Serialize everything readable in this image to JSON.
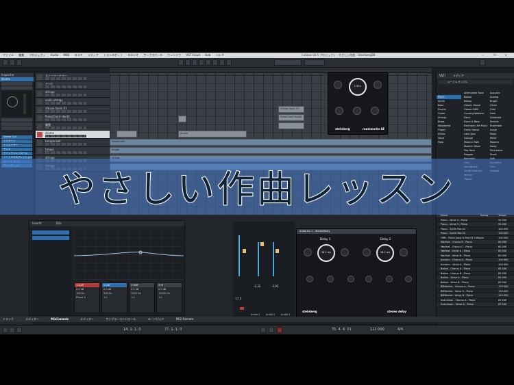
{
  "menubar": {
    "items": [
      "ファイル",
      "編集",
      "プロジェクト",
      "Audio",
      "MIDI",
      "スコア",
      "メディア",
      "トランスポート",
      "スタジオ",
      "ワークスペース",
      "ウィンドウ",
      "VST Cloud",
      "Hub",
      "ヘルプ"
    ],
    "title": "Cubase 10.5 プロジェクト - やさしい作曲 - SteinbergDB",
    "controls": "— ❐ ✕"
  },
  "project_label": "最終更新: 1/1 プロジェクト",
  "inspector": {
    "header_left": "Inspector",
    "header_right": "Visibility",
    "track_name": "drums",
    "blue_items": [
      "Stereo Out",
      "インサート",
      "イコライザー",
      "センド",
      "クイックコントロール",
      "ノートエクスプレッション",
      "コードトラック",
      "ディレクション"
    ]
  },
  "tracks": [
    {
      "name": "ストーリーテラー"
    },
    {
      "name": "アンビ"
    },
    {
      "name": "strings"
    },
    {
      "name": "violin strings"
    },
    {
      "name": "VSLow Sonic 01"
    },
    {
      "name": "PulseChord Hard4"
    },
    {
      "name": "鍵盤"
    },
    {
      "name": "drums"
    },
    {
      "name": "temple bell"
    },
    {
      "name": "tonpoi"
    },
    {
      "name": "strings"
    },
    {
      "name": "strings"
    }
  ],
  "clips": {
    "drums": "drums",
    "temple": "Inkake bell",
    "tonpoi": "tonpoi",
    "strings": "strings",
    "vs1": "VSLow Sonic 01",
    "pulse": "PulseChord Hard4"
  },
  "room_plugin": {
    "brand": "steinberg",
    "name": "roomworks SE",
    "center_value": "1.55 s",
    "values": [
      "Pre-Delay",
      "Reverb Time",
      "Diffusion",
      "Mix"
    ]
  },
  "delay_plugin": {
    "title": "Audio Ins 1 - StereoDelay",
    "brand": "steinberg",
    "name": "stereo delay",
    "delay1_label": "Delay 1",
    "delay2_label": "Delay 2",
    "delay1_value": "18.1 ms",
    "delay2_value": "18.1 ms",
    "row_labels": [
      "FEEDBACK",
      "FILTER",
      "LO",
      "HI",
      "PAN"
    ]
  },
  "media_bay": {
    "tabs": [
      "VSTi",
      "メディア"
    ],
    "search_label": "ループ & サンプル",
    "col_categories": [
      "Piano",
      "Synth",
      "Bass",
      "Drums",
      "Guitar",
      "Strings",
      "Brass",
      "Woodwind",
      "Organ",
      "Ethnic",
      "Vocal",
      "Pads"
    ],
    "col_styles": [
      "Alternative Rock",
      "Ballad",
      "Bebop",
      "Classic House",
      "Classic R&B",
      "Country/Western",
      "Disco",
      "Drum & Bass",
      "Electronic Art Music",
      "Funky House",
      "Latin Jazz",
      "Lounge",
      "Modern R&B",
      "Modern Wave",
      "Pop Rock",
      "Reggae",
      "Romantic",
      "Soul",
      "Soundtrack",
      "South America",
      "Techno",
      "Trance"
    ],
    "col_moods": [
      "Acoustic",
      "Analog",
      "Bright",
      "Clean",
      "Cold",
      "Dark",
      "Distorted",
      "Electric",
      "Ensemble",
      "Large",
      "Major",
      "Minor",
      "Modern",
      "Noisy",
      "Percussive",
      "Short",
      "Soft",
      "Synthetic",
      "Thin",
      "Vintage"
    ],
    "list_header": [
      "Name",
      "Rating",
      "Tempo"
    ],
    "list": [
      "Piano - Verse 4 - Piano",
      "Piano - Verse 5 - Piano",
      "Piano - Synth Pad 01",
      "Piano - Synth Pad 02",
      "ORB - Piano Jump & Pad 02 100bpm",
      "Warfsat - Chorus B - Piano",
      "Warfsat - Chorus C - Piano",
      "Warfsat - Verse A - Piano",
      "Warfsat - Verse B - Piano",
      "Acclaim - Chorus A - Piano",
      "Acclaim - Verse A - Piano",
      "Ballad - Chorus A - Piano",
      "Ballad - Chorus B - Piano",
      "Ballad - Verse A - Piano",
      "Ballad - Verse B - Piano",
      "BMWorlds - Chorus A - Piano",
      "BMWorlds - Verse A - Piano",
      "BMWorlds - Verse B - Piano",
      "Scandinav - Chorus A - Piano",
      "Scandinav - Verse A - Piano"
    ],
    "tempo_values": [
      "92.000",
      "92.000",
      "100.000",
      "100.000",
      "100.000",
      "60.000",
      "60.000",
      "60.000",
      "60.000",
      "104.000",
      "104.000",
      "85.000",
      "85.000",
      "85.000",
      "85.000",
      "120.000",
      "120.000",
      "120.000",
      "87.000",
      "87.000"
    ]
  },
  "banner": {
    "text": "やさしい作曲レッスン"
  },
  "eq": {
    "tabs": [
      "Inserts",
      "EQs"
    ],
    "band_labels": [
      "1 LOW",
      "2 LMF",
      "3 HMF",
      "4 HI"
    ],
    "band_values": [
      [
        "0.0 dB",
        "100 Hz",
        "1.0"
      ],
      [
        "0.0 dB",
        "500 Hz",
        "1.0"
      ],
      [
        "0.0 dB",
        "2000 Hz",
        "1.0"
      ],
      [
        "0.0 dB",
        "12000 Hz",
        "1.0"
      ]
    ],
    "phase_label": "Phase 0",
    "channel_name": "drums"
  },
  "mixer": {
    "values": [
      "-2.32",
      "-3.93",
      "-17.2"
    ],
    "channel_labels": [
      "Audio 1",
      "Audio 2",
      "Audio 3"
    ]
  },
  "lower_tabs": [
    "トラック",
    "エディター",
    "MixConsole",
    "エディター",
    "サンプラーコントロール",
    "コードパッド",
    "MIDI Remote"
  ],
  "transport": {
    "left_pos": "14. 1. 1. 0",
    "right_pos": "77. 1. 1. 0",
    "main_pos": "75. 4. 4. 21",
    "tempo": "112.000",
    "signature": "4/4"
  }
}
